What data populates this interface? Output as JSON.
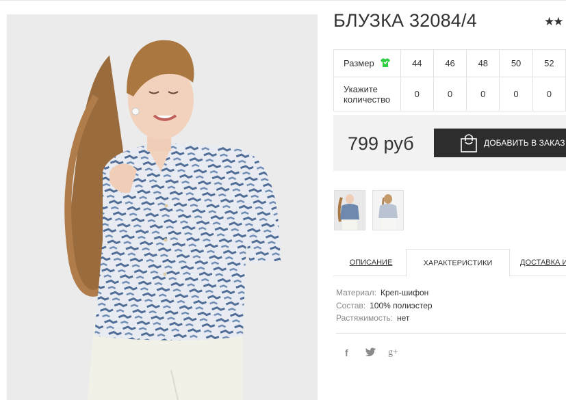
{
  "product": {
    "title": "БЛУЗКА 32084/4",
    "rating_stars": "★★"
  },
  "size_table": {
    "size_label": "Размер",
    "qty_label_line1": "Укажите",
    "qty_label_line2": "количество",
    "sizes": [
      "44",
      "46",
      "48",
      "50",
      "52"
    ],
    "quantities": [
      "0",
      "0",
      "0",
      "0",
      "0"
    ]
  },
  "purchase": {
    "price": "799 руб",
    "add_button_label": "ДОБАВИТЬ В ЗАКАЗ"
  },
  "tabs": [
    {
      "label": "ОПИСАНИЕ"
    },
    {
      "label": "ХАРАКТЕРИСТИКИ"
    },
    {
      "label": "ДОСТАВКА И ОПЛАТА"
    }
  ],
  "characteristics": [
    {
      "key": "Материал:",
      "value": "Креп-шифон"
    },
    {
      "key": "Состав:",
      "value": "100% полиэстер"
    },
    {
      "key": "Растяжимость:",
      "value": "нет"
    }
  ],
  "social": {
    "facebook": "f",
    "twitter": "🐦",
    "google_plus": "g+"
  },
  "colors": {
    "button_bg": "#2d2d2d",
    "price_bg": "#f2f2f2",
    "size_icon": "#2ecc40",
    "blouse_pattern": "#5a78a0"
  }
}
